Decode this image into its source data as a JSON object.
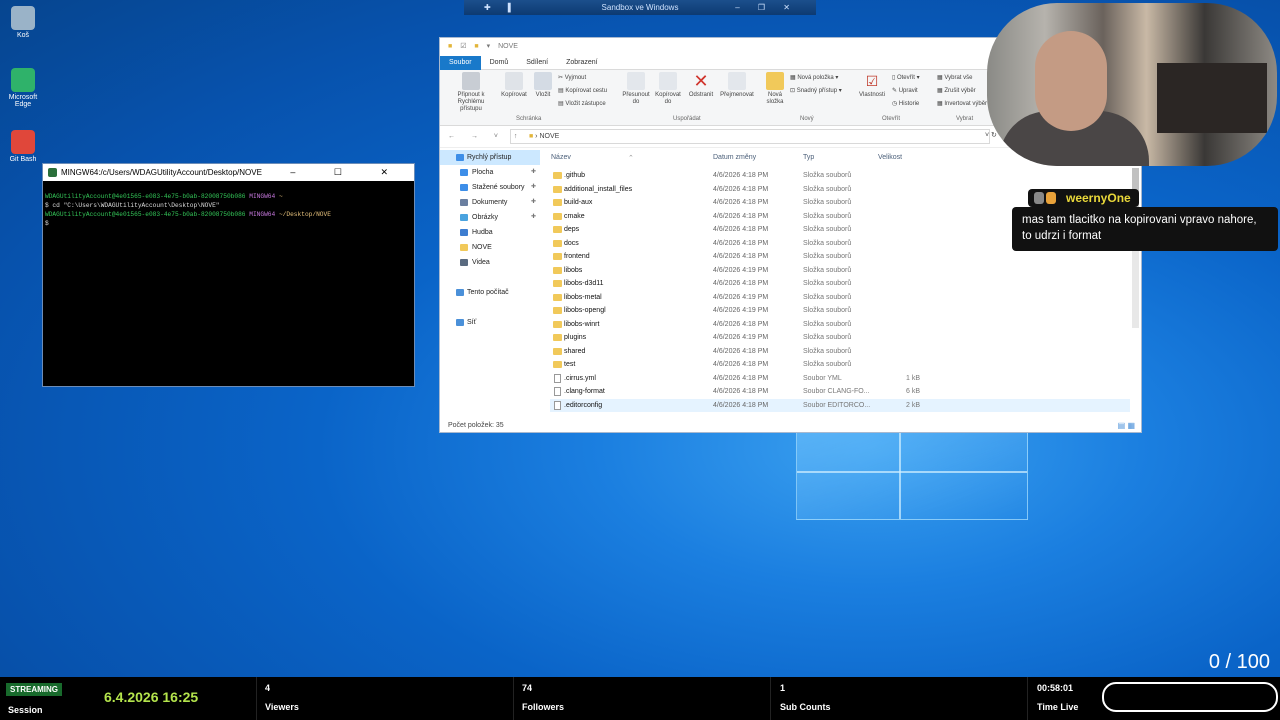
{
  "desktop": {
    "icons": [
      {
        "label": "Koš",
        "color": "#9ab3c8"
      },
      {
        "label": "Microsoft Edge",
        "color": "#2fb26a"
      },
      {
        "label": "Git Bash",
        "color": "#e0473a"
      }
    ]
  },
  "sandbox_bar": {
    "title": "Sandbox ve Windows"
  },
  "terminal": {
    "title": "MINGW64:/c/Users/WDAGUtilityAccount/Desktop/NOVE",
    "lines": [
      {
        "user": "WDAGUtilityAccount@4e01565-e083-4e75-b0ab-82008750b086",
        "shell": "MINGW64",
        "path": "~"
      },
      {
        "cmd": "$ cd \"C:\\Users\\WDAGUtilityAccount\\Desktop\\NOVE\""
      },
      {
        "user": "WDAGUtilityAccount@4e01565-e083-4e75-b0ab-82008750b086",
        "shell": "MINGW64",
        "path": "~/Desktop/NOVE"
      },
      {
        "cmd": "$"
      }
    ]
  },
  "explorer": {
    "title": "NOVE",
    "tabs": [
      "Soubor",
      "Domů",
      "Sdílení",
      "Zobrazení"
    ],
    "ribbon": {
      "pin": "Připnout k Rychlému přístupu",
      "copy": "Kopírovat",
      "paste": "Vložit",
      "cut": "Vyjmout",
      "copy_path": "Kopírovat cestu",
      "paste_shortcut": "Vložit zástupce",
      "group_clipboard": "Schránka",
      "move_to": "Přesunout do",
      "copy_to": "Kopírovat do",
      "delete": "Odstranit",
      "rename": "Přejmenovat",
      "group_organize": "Uspořádat",
      "new_folder": "Nová složka",
      "new_item": "Nová položka",
      "easy_access": "Snadný přístup",
      "group_new": "Nový",
      "properties": "Vlastnosti",
      "open": "Otevřít",
      "edit": "Upravit",
      "history": "Historie",
      "group_open": "Otevřít",
      "select_all": "Vybrat vše",
      "select_none": "Zrušit výběr",
      "invert": "Invertovat výběr",
      "group_select": "Vybrat"
    },
    "address": "NOVE",
    "nav": [
      {
        "label": "Rychlý přístup",
        "level": 0,
        "selected": true,
        "pin": false,
        "color": "#3d8ee8"
      },
      {
        "label": "Plocha",
        "level": 1,
        "selected": false,
        "pin": true,
        "color": "#3d8ee8"
      },
      {
        "label": "Stažené soubory",
        "level": 1,
        "selected": false,
        "pin": true,
        "color": "#3d8ee8"
      },
      {
        "label": "Dokumenty",
        "level": 1,
        "selected": false,
        "pin": true,
        "color": "#6a7fa0"
      },
      {
        "label": "Obrázky",
        "level": 1,
        "selected": false,
        "pin": true,
        "color": "#4aa3df"
      },
      {
        "label": "Hudba",
        "level": 1,
        "selected": false,
        "pin": false,
        "color": "#3d7dd0"
      },
      {
        "label": "NOVE",
        "level": 1,
        "selected": false,
        "pin": false,
        "color": "#f1c95a"
      },
      {
        "label": "Videa",
        "level": 1,
        "selected": false,
        "pin": false,
        "color": "#5a6b80"
      },
      {
        "label": "",
        "level": 1,
        "selected": false,
        "pin": false,
        "color": "transparent"
      },
      {
        "label": "Tento počítač",
        "level": 0,
        "selected": false,
        "pin": false,
        "color": "#4a90d9"
      },
      {
        "label": "",
        "level": 1,
        "selected": false,
        "pin": false,
        "color": "transparent"
      },
      {
        "label": "Síť",
        "level": 0,
        "selected": false,
        "pin": false,
        "color": "#4a90d9"
      }
    ],
    "columns": {
      "name": "Název",
      "date": "Datum změny",
      "type": "Typ",
      "size": "Velikost"
    },
    "files": [
      {
        "name": ".github",
        "date": "4/6/2026 4:18 PM",
        "type": "Složka souborů",
        "size": "",
        "folder": true
      },
      {
        "name": "additional_install_files",
        "date": "4/6/2026 4:18 PM",
        "type": "Složka souborů",
        "size": "",
        "folder": true
      },
      {
        "name": "build-aux",
        "date": "4/6/2026 4:18 PM",
        "type": "Složka souborů",
        "size": "",
        "folder": true
      },
      {
        "name": "cmake",
        "date": "4/6/2026 4:18 PM",
        "type": "Složka souborů",
        "size": "",
        "folder": true
      },
      {
        "name": "deps",
        "date": "4/6/2026 4:18 PM",
        "type": "Složka souborů",
        "size": "",
        "folder": true
      },
      {
        "name": "docs",
        "date": "4/6/2026 4:18 PM",
        "type": "Složka souborů",
        "size": "",
        "folder": true
      },
      {
        "name": "frontend",
        "date": "4/6/2026 4:18 PM",
        "type": "Složka souborů",
        "size": "",
        "folder": true
      },
      {
        "name": "libobs",
        "date": "4/6/2026 4:19 PM",
        "type": "Složka souborů",
        "size": "",
        "folder": true
      },
      {
        "name": "libobs-d3d11",
        "date": "4/6/2026 4:18 PM",
        "type": "Složka souborů",
        "size": "",
        "folder": true
      },
      {
        "name": "libobs-metal",
        "date": "4/6/2026 4:19 PM",
        "type": "Složka souborů",
        "size": "",
        "folder": true
      },
      {
        "name": "libobs-opengl",
        "date": "4/6/2026 4:19 PM",
        "type": "Složka souborů",
        "size": "",
        "folder": true
      },
      {
        "name": "libobs-winrt",
        "date": "4/6/2026 4:18 PM",
        "type": "Složka souborů",
        "size": "",
        "folder": true
      },
      {
        "name": "plugins",
        "date": "4/6/2026 4:19 PM",
        "type": "Složka souborů",
        "size": "",
        "folder": true
      },
      {
        "name": "shared",
        "date": "4/6/2026 4:18 PM",
        "type": "Složka souborů",
        "size": "",
        "folder": true
      },
      {
        "name": "test",
        "date": "4/6/2026 4:18 PM",
        "type": "Složka souborů",
        "size": "",
        "folder": true
      },
      {
        "name": ".cirrus.yml",
        "date": "4/6/2026 4:18 PM",
        "type": "Soubor YML",
        "size": "1 kB",
        "folder": false
      },
      {
        "name": ".clang-format",
        "date": "4/6/2026 4:18 PM",
        "type": "Soubor CLANG-FO...",
        "size": "6 kB",
        "folder": false
      },
      {
        "name": ".editorconfig",
        "date": "4/6/2026 4:18 PM",
        "type": "Soubor EDITORCO...",
        "size": "2 kB",
        "folder": false
      }
    ],
    "status": "Počet položek: 35"
  },
  "chat": {
    "username": "weernyOne",
    "message": "mas tam tlacitko na kopirovani vpravo nahore, to udrzi i format"
  },
  "goal": "0 / 100",
  "bottom": {
    "streaming": "STREAMING",
    "session": "Session",
    "datetime": "6.4.2026 16:25",
    "viewers_value": "4",
    "viewers_label": "Viewers",
    "followers_value": "74",
    "followers_label": "Followers",
    "subs_value": "1",
    "subs_label": "Sub Counts",
    "time_value": "00:58:01",
    "time_label": "Time Live"
  }
}
